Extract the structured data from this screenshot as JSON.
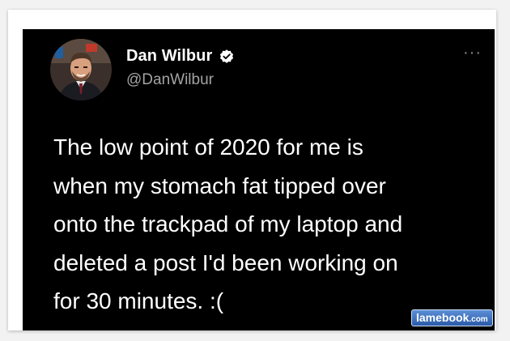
{
  "tweet": {
    "author": {
      "display_name": "Dan Wilbur",
      "handle": "@DanWilbur",
      "verified": true,
      "avatar_icon": "profile-photo"
    },
    "more_icon": "more-horizontal-icon",
    "text": "The low point of 2020 for me is\nwhen my stomach fat tipped over\nonto the trackpad of my laptop and\ndeleted a post I'd been working on\nfor 30 minutes. :("
  },
  "watermark": {
    "name": "lamebook",
    "tld": ".com"
  },
  "colors": {
    "background": "#000000",
    "text": "#ffffff",
    "handle": "#a3a3a3",
    "watermark_blue": "#2b5aa8"
  }
}
